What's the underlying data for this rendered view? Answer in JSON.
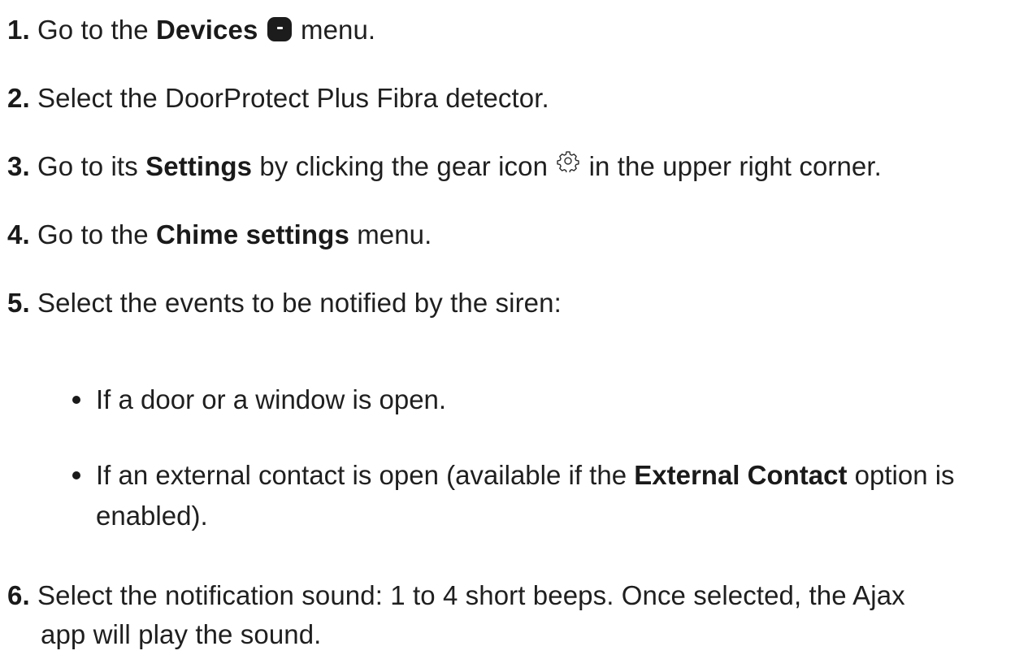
{
  "steps": [
    {
      "num": "1.",
      "before": "Go to the",
      "bold": "Devices",
      "icon": "devices-icon",
      "after": "menu."
    },
    {
      "num": "2.",
      "text": "Select the DoorProtect Plus Fibra detector."
    },
    {
      "num": "3.",
      "before": "Go to its",
      "bold": "Settings",
      "middle": "by clicking the gear icon",
      "icon": "gear-icon",
      "after": "in the upper right corner."
    },
    {
      "num": "4.",
      "before": "Go to the",
      "bold": "Chime settings",
      "after": "menu."
    },
    {
      "num": "5.",
      "text": "Select the events to be notified by the siren:"
    },
    {
      "num": "6.",
      "line1": "Select the notification sound: 1 to 4 short beeps. Once selected, the Ajax",
      "line2": "app will play the sound."
    }
  ],
  "bullets": [
    {
      "text": "If a door or a window is open."
    },
    {
      "before": "If an external contact is open (available if the",
      "bold": "External Contact",
      "after": "option is",
      "line2": "enabled)."
    }
  ]
}
